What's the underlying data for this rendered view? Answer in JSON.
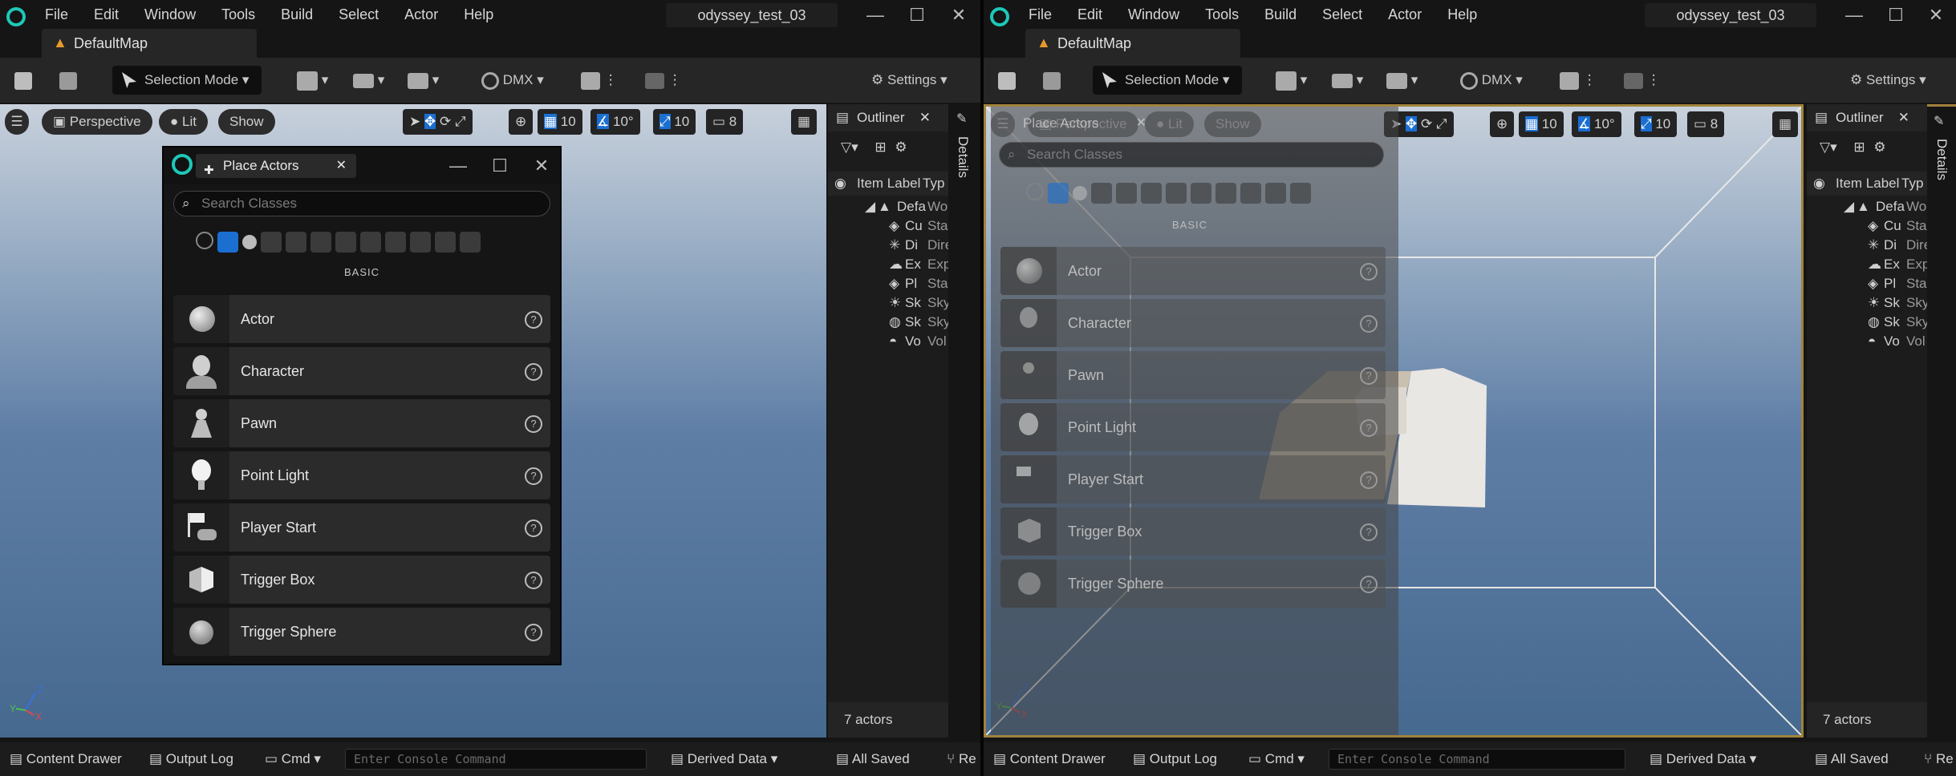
{
  "menu": [
    "File",
    "Edit",
    "Window",
    "Tools",
    "Build",
    "Select",
    "Actor",
    "Help"
  ],
  "window_title": "odyssey_test_03",
  "window_controls": {
    "minimize": "—",
    "maximize": "☐",
    "close": "✕"
  },
  "doc_tab": "DefaultMap",
  "toolbar": {
    "selection_mode": "Selection Mode",
    "dmx": "DMX",
    "settings": "Settings"
  },
  "viewport": {
    "perspective": "Perspective",
    "lit": "Lit",
    "show": "Show",
    "grid_snap": "10",
    "rot_snap": "10°",
    "scale_snap": "10",
    "camera_speed": "8",
    "axis_z": "Z",
    "axis_x": "X",
    "axis_y": "Y"
  },
  "outliner": {
    "title": "Outliner",
    "col_item_label": "Item Label",
    "col_type": "Typ",
    "root_label": "Defa",
    "root_type": "Wo",
    "rows": [
      {
        "label": "Cu",
        "type": "Sta",
        "icon": "cube-mesh-icon"
      },
      {
        "label": "Di",
        "type": "Dire",
        "icon": "directional-light-icon"
      },
      {
        "label": "Ex",
        "type": "Exp",
        "icon": "fog-icon"
      },
      {
        "label": "Pl",
        "type": "Sta",
        "icon": "cube-mesh-icon"
      },
      {
        "label": "Sk",
        "type": "Sky",
        "icon": "sky-light-icon"
      },
      {
        "label": "Sk",
        "type": "Sky",
        "icon": "sky-atmosphere-icon"
      },
      {
        "label": "Vo",
        "type": "Vol",
        "icon": "volumetric-cloud-icon"
      }
    ],
    "actor_count": "7 actors"
  },
  "details_label": "Details",
  "place_actors": {
    "tab_label": "Place Actors",
    "search_placeholder": "Search Classes",
    "section": "BASIC",
    "items": [
      {
        "label": "Actor",
        "icon": "sphere-actor-icon"
      },
      {
        "label": "Character",
        "icon": "character-bust-icon"
      },
      {
        "label": "Pawn",
        "icon": "pawn-icon"
      },
      {
        "label": "Point Light",
        "icon": "light-bulb-icon"
      },
      {
        "label": "Player Start",
        "icon": "player-start-flag-icon"
      },
      {
        "label": "Trigger Box",
        "icon": "trigger-box-icon"
      },
      {
        "label": "Trigger Sphere",
        "icon": "trigger-sphere-icon"
      }
    ],
    "help_glyph": "?"
  },
  "statusbar": {
    "content_drawer": "Content Drawer",
    "output_log": "Output Log",
    "cmd": "Cmd",
    "console_placeholder": "Enter Console Command",
    "derived_data": "Derived Data",
    "all_saved": "All Saved",
    "revision": "Re"
  },
  "colors": {
    "accent": "#1a6fd1",
    "logo": "#1ec8b8",
    "map_icon": "#e89a2c"
  }
}
